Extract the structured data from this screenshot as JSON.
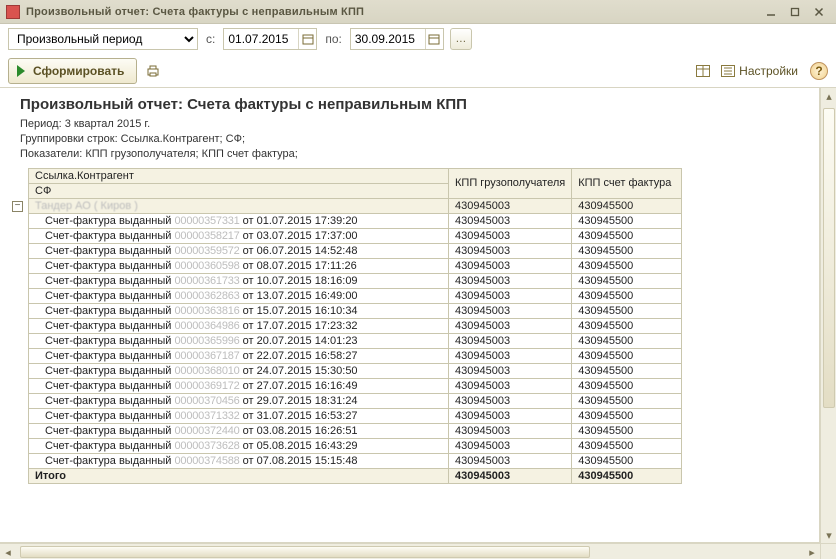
{
  "window": {
    "title": "Произвольный отчет: Счета фактуры с неправильным КПП"
  },
  "toolbar": {
    "period_option": "Произвольный период",
    "from_label": "с:",
    "to_label": "по:",
    "date_from": "01.07.2015",
    "date_to": "30.09.2015",
    "form_button": "Сформировать",
    "settings_label": "Настройки"
  },
  "report": {
    "title": "Произвольный отчет: Счета фактуры с неправильным КПП",
    "meta_period": "Период: 3 квартал 2015 г.",
    "meta_groups": "Группировки строк: Ссылка.Контрагент; СФ;",
    "meta_measures": "Показатели: КПП грузополучателя; КПП счет фактура;",
    "columns": {
      "main1": "Ссылка.Контрагент",
      "main2": "СФ",
      "kpp1": "КПП грузополучателя",
      "kpp2": "КПП счет фактура"
    },
    "group": {
      "counterparty": "Тандер АО ( Киров )",
      "kpp1": "430945003",
      "kpp2": "430945500"
    },
    "rows": [
      {
        "prefix": "Счет-фактура выданный",
        "num": "00000357331",
        "tail": " от 01.07.2015 17:39:20",
        "kpp1": "430945003",
        "kpp2": "430945500"
      },
      {
        "prefix": "Счет-фактура выданный",
        "num": "00000358217",
        "tail": " от 03.07.2015 17:37:00",
        "kpp1": "430945003",
        "kpp2": "430945500"
      },
      {
        "prefix": "Счет-фактура выданный",
        "num": "00000359572",
        "tail": " от 06.07.2015 14:52:48",
        "kpp1": "430945003",
        "kpp2": "430945500"
      },
      {
        "prefix": "Счет-фактура выданный",
        "num": "00000360598",
        "tail": " от 08.07.2015 17:11:26",
        "kpp1": "430945003",
        "kpp2": "430945500"
      },
      {
        "prefix": "Счет-фактура выданный",
        "num": "00000361733",
        "tail": " от 10.07.2015 18:16:09",
        "kpp1": "430945003",
        "kpp2": "430945500"
      },
      {
        "prefix": "Счет-фактура выданный",
        "num": "00000362863",
        "tail": " от 13.07.2015 16:49:00",
        "kpp1": "430945003",
        "kpp2": "430945500"
      },
      {
        "prefix": "Счет-фактура выданный",
        "num": "00000363816",
        "tail": " от 15.07.2015 16:10:34",
        "kpp1": "430945003",
        "kpp2": "430945500"
      },
      {
        "prefix": "Счет-фактура выданный",
        "num": "00000364986",
        "tail": " от 17.07.2015 17:23:32",
        "kpp1": "430945003",
        "kpp2": "430945500"
      },
      {
        "prefix": "Счет-фактура выданный",
        "num": "00000365996",
        "tail": " от 20.07.2015 14:01:23",
        "kpp1": "430945003",
        "kpp2": "430945500"
      },
      {
        "prefix": "Счет-фактура выданный",
        "num": "00000367187",
        "tail": " от 22.07.2015 16:58:27",
        "kpp1": "430945003",
        "kpp2": "430945500"
      },
      {
        "prefix": "Счет-фактура выданный",
        "num": "00000368010",
        "tail": " от 24.07.2015 15:30:50",
        "kpp1": "430945003",
        "kpp2": "430945500"
      },
      {
        "prefix": "Счет-фактура выданный",
        "num": "00000369172",
        "tail": " от 27.07.2015 16:16:49",
        "kpp1": "430945003",
        "kpp2": "430945500"
      },
      {
        "prefix": "Счет-фактура выданный",
        "num": "00000370456",
        "tail": " от 29.07.2015 18:31:24",
        "kpp1": "430945003",
        "kpp2": "430945500"
      },
      {
        "prefix": "Счет-фактура выданный",
        "num": "00000371332",
        "tail": " от 31.07.2015 16:53:27",
        "kpp1": "430945003",
        "kpp2": "430945500"
      },
      {
        "prefix": "Счет-фактура выданный",
        "num": "00000372440",
        "tail": " от 03.08.2015 16:26:51",
        "kpp1": "430945003",
        "kpp2": "430945500"
      },
      {
        "prefix": "Счет-фактура выданный",
        "num": "00000373628",
        "tail": " от 05.08.2015 16:43:29",
        "kpp1": "430945003",
        "kpp2": "430945500"
      },
      {
        "prefix": "Счет-фактура выданный",
        "num": "00000374588",
        "tail": " от 07.08.2015 15:15:48",
        "kpp1": "430945003",
        "kpp2": "430945500"
      }
    ],
    "total": {
      "label": "Итого",
      "kpp1": "430945003",
      "kpp2": "430945500"
    }
  }
}
